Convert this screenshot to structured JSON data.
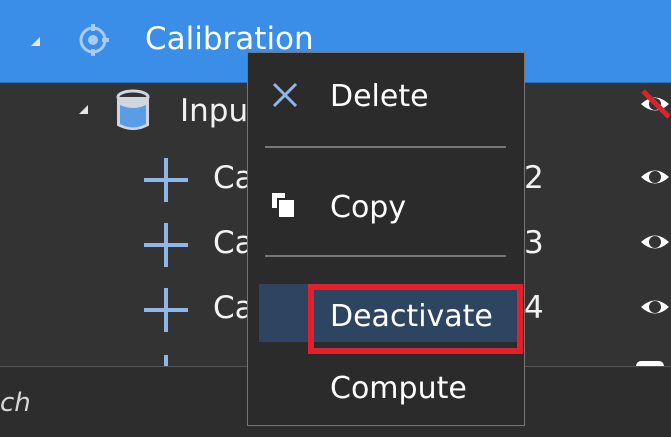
{
  "tree": {
    "calibration": {
      "label": "Calibration",
      "icon": "target-icon",
      "expanded": true
    },
    "input": {
      "label": "Inpu",
      "icon": "cylinder-icon",
      "expanded": true,
      "visibility": "hidden-eye-icon"
    },
    "children": [
      {
        "label": "Ca",
        "suffix": "2",
        "icon": "cross-icon",
        "visibility": "eye-icon"
      },
      {
        "label": "Ca",
        "suffix": "3",
        "icon": "cross-icon",
        "visibility": "eye-icon"
      },
      {
        "label": "Ca",
        "suffix": "4",
        "icon": "cross-icon",
        "visibility": "eye-icon"
      }
    ]
  },
  "statusbar": {
    "text": "ch"
  },
  "context_menu": {
    "items": [
      {
        "label": "Delete",
        "icon": "close-icon"
      },
      {
        "label": "Copy",
        "icon": "copy-icon"
      },
      {
        "label": "Deactivate",
        "icon": "",
        "highlighted": true
      },
      {
        "label": "Compute",
        "icon": ""
      }
    ]
  },
  "colors": {
    "selected_row": "#3b8ee8",
    "background": "#333333",
    "menu_background": "#2b2b2b",
    "highlight_box": "#e0202a",
    "hidden_slash": "#e0202a"
  }
}
